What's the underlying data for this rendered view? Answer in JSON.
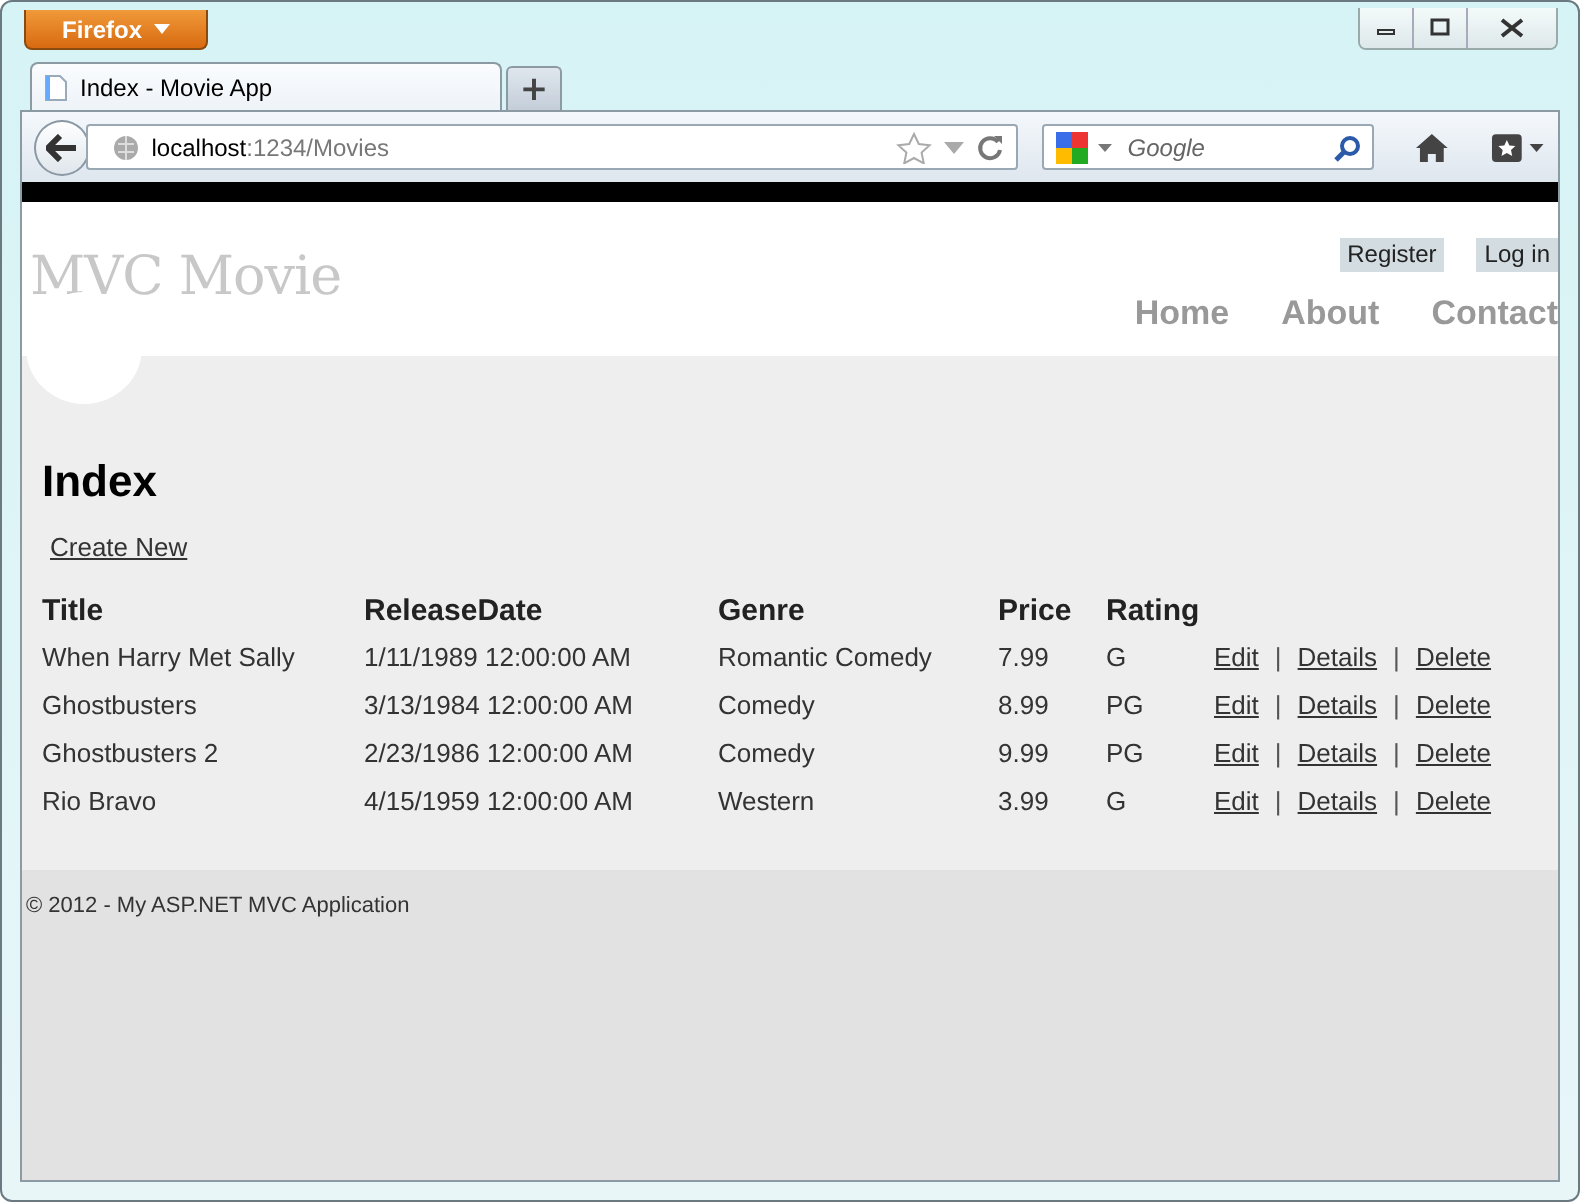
{
  "browser": {
    "menu_button": "Firefox",
    "tab": {
      "title": "Index - Movie App",
      "selected": true
    },
    "new_tab": "+",
    "url_host": "localhost",
    "url_path": ":1234/Movies",
    "search_placeholder": "Google"
  },
  "site": {
    "logo": "MVC Movie",
    "account_links": [
      "Register",
      "Log in"
    ],
    "nav": [
      "Home",
      "About",
      "Contact"
    ]
  },
  "page": {
    "heading": "Index",
    "create_link": "Create New",
    "table": {
      "columns": [
        "Title",
        "ReleaseDate",
        "Genre",
        "Price",
        "Rating"
      ],
      "rows": [
        {
          "cells": [
            "When Harry Met Sally",
            "1/11/1989 12:00:00 AM",
            "Romantic Comedy",
            "7.99",
            "G"
          ],
          "links": [
            "Edit",
            "Details",
            "Delete"
          ],
          "separators": [
            "|",
            "|"
          ]
        },
        {
          "cells": [
            "Ghostbusters",
            "3/13/1984 12:00:00 AM",
            "Comedy",
            "8.99",
            "PG"
          ],
          "links": [
            "Edit",
            "Details",
            "Delete"
          ],
          "separators": [
            "|",
            "|"
          ]
        },
        {
          "cells": [
            "Ghostbusters 2",
            "2/23/1986 12:00:00 AM",
            "Comedy",
            "9.99",
            "PG"
          ],
          "links": [
            "Edit",
            "Details",
            "Delete"
          ],
          "separators": [
            "|",
            "|"
          ]
        },
        {
          "cells": [
            "Rio Bravo",
            "4/15/1959 12:00:00 AM",
            "Western",
            "3.99",
            "G"
          ],
          "links": [
            "Edit",
            "Details",
            "Delete"
          ],
          "separators": [
            "|",
            "|"
          ]
        }
      ]
    }
  },
  "footer": "© 2012 - My ASP.NET MVC Application"
}
